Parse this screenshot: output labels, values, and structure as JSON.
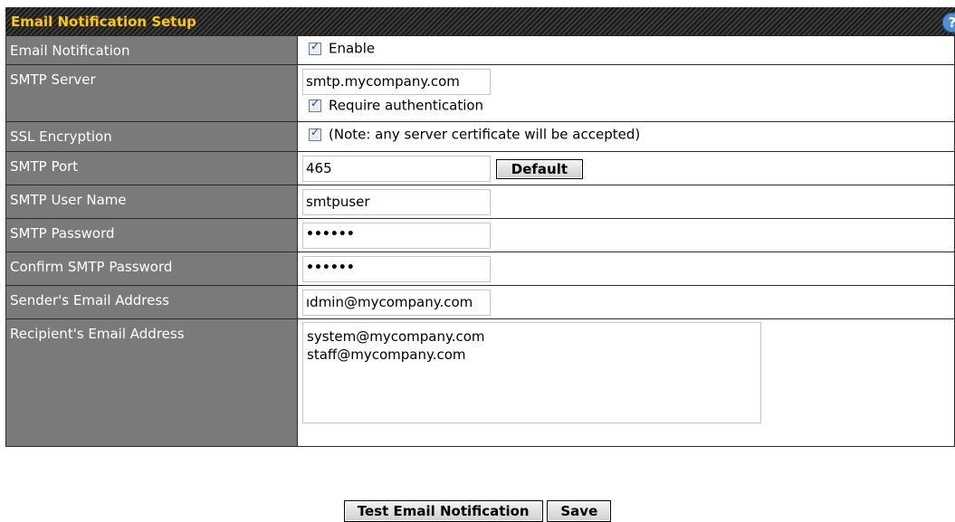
{
  "panel": {
    "title": "Email Notification Setup",
    "help_glyph": "?"
  },
  "rows": {
    "email_notification": {
      "label": "Email Notification",
      "checkbox_label": "Enable",
      "checked": true
    },
    "smtp_server": {
      "label": "SMTP Server",
      "value": "smtp.mycompany.com",
      "auth_label": "Require authentication",
      "auth_checked": true
    },
    "ssl": {
      "label": "SSL Encryption",
      "checkbox_label": "(Note: any server certificate will be accepted)",
      "checked": true
    },
    "smtp_port": {
      "label": "SMTP Port",
      "value": "465",
      "default_button": "Default"
    },
    "smtp_user": {
      "label": "SMTP User Name",
      "value": "smtpuser"
    },
    "smtp_password": {
      "label": "SMTP Password",
      "value": "••••••"
    },
    "confirm_password": {
      "label": "Confirm SMTP Password",
      "value": "••••••"
    },
    "sender": {
      "label": "Sender's Email Address",
      "value": "ıdmin@mycompany.com"
    },
    "recipient": {
      "label": "Recipient's Email Address",
      "value": "system@mycompany.com\nstaff@mycompany.com"
    }
  },
  "footer": {
    "test_button": "Test Email Notification",
    "save_button": "Save"
  }
}
